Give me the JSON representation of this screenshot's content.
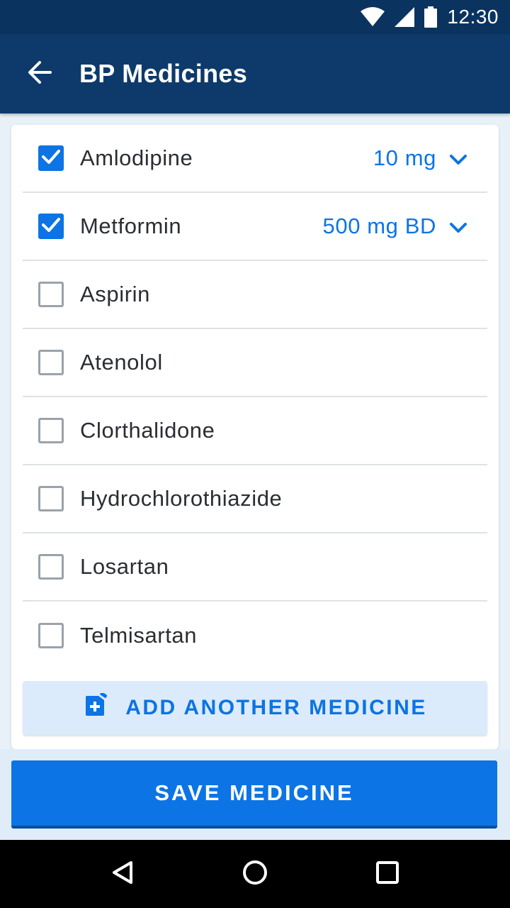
{
  "status_bar": {
    "time": "12:30",
    "icons": [
      "wifi-icon",
      "signal-icon",
      "battery-icon"
    ]
  },
  "app_bar": {
    "title": "BP Medicines",
    "back_icon": "arrow-back-icon"
  },
  "medicines": [
    {
      "name": "Amlodipine",
      "checked": true,
      "dosage": "10 mg"
    },
    {
      "name": "Metformin",
      "checked": true,
      "dosage": "500 mg BD"
    },
    {
      "name": "Aspirin",
      "checked": false
    },
    {
      "name": "Atenolol",
      "checked": false
    },
    {
      "name": "Clorthalidone",
      "checked": false
    },
    {
      "name": "Hydrochlorothiazide",
      "checked": false
    },
    {
      "name": "Losartan",
      "checked": false
    },
    {
      "name": "Telmisartan",
      "checked": false
    }
  ],
  "add_button": {
    "label": "ADD ANOTHER MEDICINE",
    "icon": "add-medicine-icon"
  },
  "save_button": {
    "label": "SAVE MEDICINE"
  },
  "nav_bar": {
    "icons": [
      "back-triangle-icon",
      "home-circle-icon",
      "recents-square-icon"
    ]
  },
  "colors": {
    "primary_dark": "#0d3a6b",
    "status_bar": "#0b3360",
    "accent": "#0c74e4",
    "add_button_bg": "#dcebfb"
  }
}
